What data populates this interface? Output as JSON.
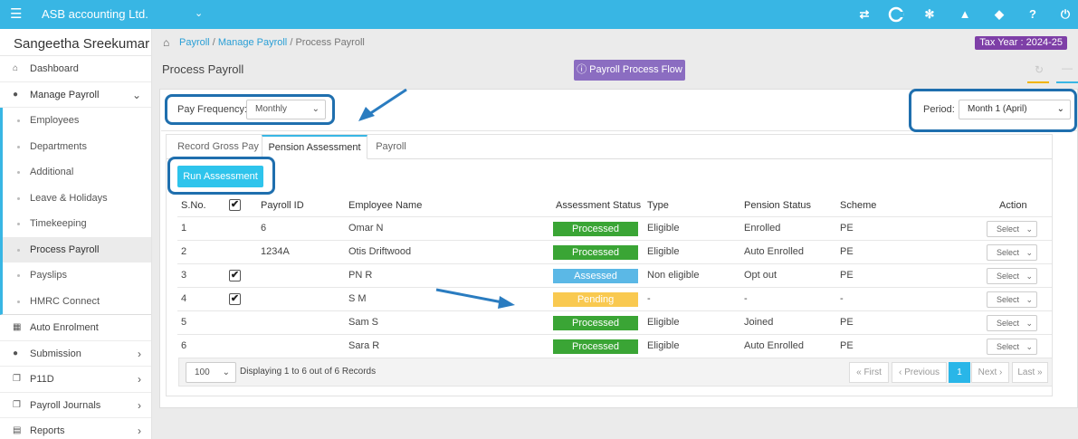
{
  "topbar": {
    "menu_icon": "hamburger-icon",
    "company": "ASB accounting Ltd.",
    "company_caret": "⌄",
    "icons": [
      "swap-icon",
      "c-logo-icon",
      "cogs-icon",
      "megaphone-icon",
      "ticket-icon",
      "help-icon",
      "power-icon"
    ]
  },
  "sidebar": {
    "user": "Sangeetha Sreekumar",
    "items_top": [
      {
        "label": "Dashboard",
        "icon": "home-icon"
      },
      {
        "label": "Manage Payroll",
        "icon": "user-icon"
      }
    ],
    "sub_items": [
      {
        "label": "Employees"
      },
      {
        "label": "Departments"
      },
      {
        "label": "Additional"
      },
      {
        "label": "Leave & Holidays"
      },
      {
        "label": "Timekeeping"
      },
      {
        "label": "Process Payroll"
      },
      {
        "label": "Payslips"
      },
      {
        "label": "HMRC Connect"
      }
    ],
    "items_bottom": [
      {
        "label": "Auto Enrolment",
        "icon": "grid-icon"
      },
      {
        "label": "Submission",
        "icon": "users-icon"
      },
      {
        "label": "P11D",
        "icon": "copy-icon"
      },
      {
        "label": "Payroll Journals",
        "icon": "copy-icon"
      },
      {
        "label": "Reports",
        "icon": "document-icon"
      }
    ]
  },
  "breadcrumb": {
    "home_icon": "home-icon",
    "items": [
      "Payroll",
      "Manage Payroll",
      "Process Payroll"
    ],
    "separator": "/",
    "tax_year": "Tax Year : 2024-25"
  },
  "page": {
    "title": "Process Payroll",
    "flow_button": "Payroll Process Flow",
    "flow_icon": "info-circle-icon"
  },
  "filters": {
    "pay_frequency_label": "Pay Frequency:",
    "pay_frequency_value": "Monthly",
    "period_label": "Period:",
    "period_value": "Month 1 (April)"
  },
  "tabs": [
    "Record Gross Pay",
    "Pension Assessment",
    "Payroll"
  ],
  "active_tab": "Pension Assessment",
  "run_button": "Run Assessment",
  "table": {
    "headers": [
      "S.No.",
      "",
      "Payroll ID",
      "Employee Name",
      "Assessment Status",
      "Type",
      "Pension Status",
      "Scheme",
      "Action"
    ],
    "header_checkbox": true,
    "rows": [
      {
        "sno": "1",
        "checked": false,
        "payroll_id": "6",
        "name": "Omar N",
        "status": "Processed",
        "status_color": "#3aa535",
        "type": "Eligible",
        "pension": "Enrolled",
        "scheme": "PE",
        "action": "Select"
      },
      {
        "sno": "2",
        "checked": false,
        "payroll_id": "1234A",
        "name": "Otis Driftwood",
        "status": "Processed",
        "status_color": "#3aa535",
        "type": "Eligible",
        "pension": "Auto Enrolled",
        "scheme": "PE",
        "action": "Select"
      },
      {
        "sno": "3",
        "checked": true,
        "payroll_id": "",
        "name": "PN R",
        "status": "Assessed",
        "status_color": "#5bb8e6",
        "type": "Non eligible",
        "pension": "Opt out",
        "scheme": "PE",
        "action": "Select"
      },
      {
        "sno": "4",
        "checked": true,
        "payroll_id": "",
        "name": "S M",
        "status": "Pending",
        "status_color": "#f9c950",
        "type": "-",
        "pension": "-",
        "scheme": "-",
        "action": "Select"
      },
      {
        "sno": "5",
        "checked": false,
        "payroll_id": "",
        "name": "Sam S",
        "status": "Processed",
        "status_color": "#3aa535",
        "type": "Eligible",
        "pension": "Joined",
        "scheme": "PE",
        "action": "Select"
      },
      {
        "sno": "6",
        "checked": false,
        "payroll_id": "",
        "name": "Sara R",
        "status": "Processed",
        "status_color": "#3aa535",
        "type": "Eligible",
        "pension": "Auto Enrolled",
        "scheme": "PE",
        "action": "Select"
      }
    ]
  },
  "footer": {
    "page_size": "100",
    "display_text": "Displaying 1 to 6 out of 6 Records",
    "first": "« First",
    "previous": "‹ Previous",
    "current": "1",
    "next": "Next ›",
    "last": "Last »"
  },
  "colors": {
    "accent": "#38b6e4",
    "tax_year": "#7e3fa7",
    "flow_button": "#8b6dc1",
    "highlight_box": "#1f6fae"
  }
}
